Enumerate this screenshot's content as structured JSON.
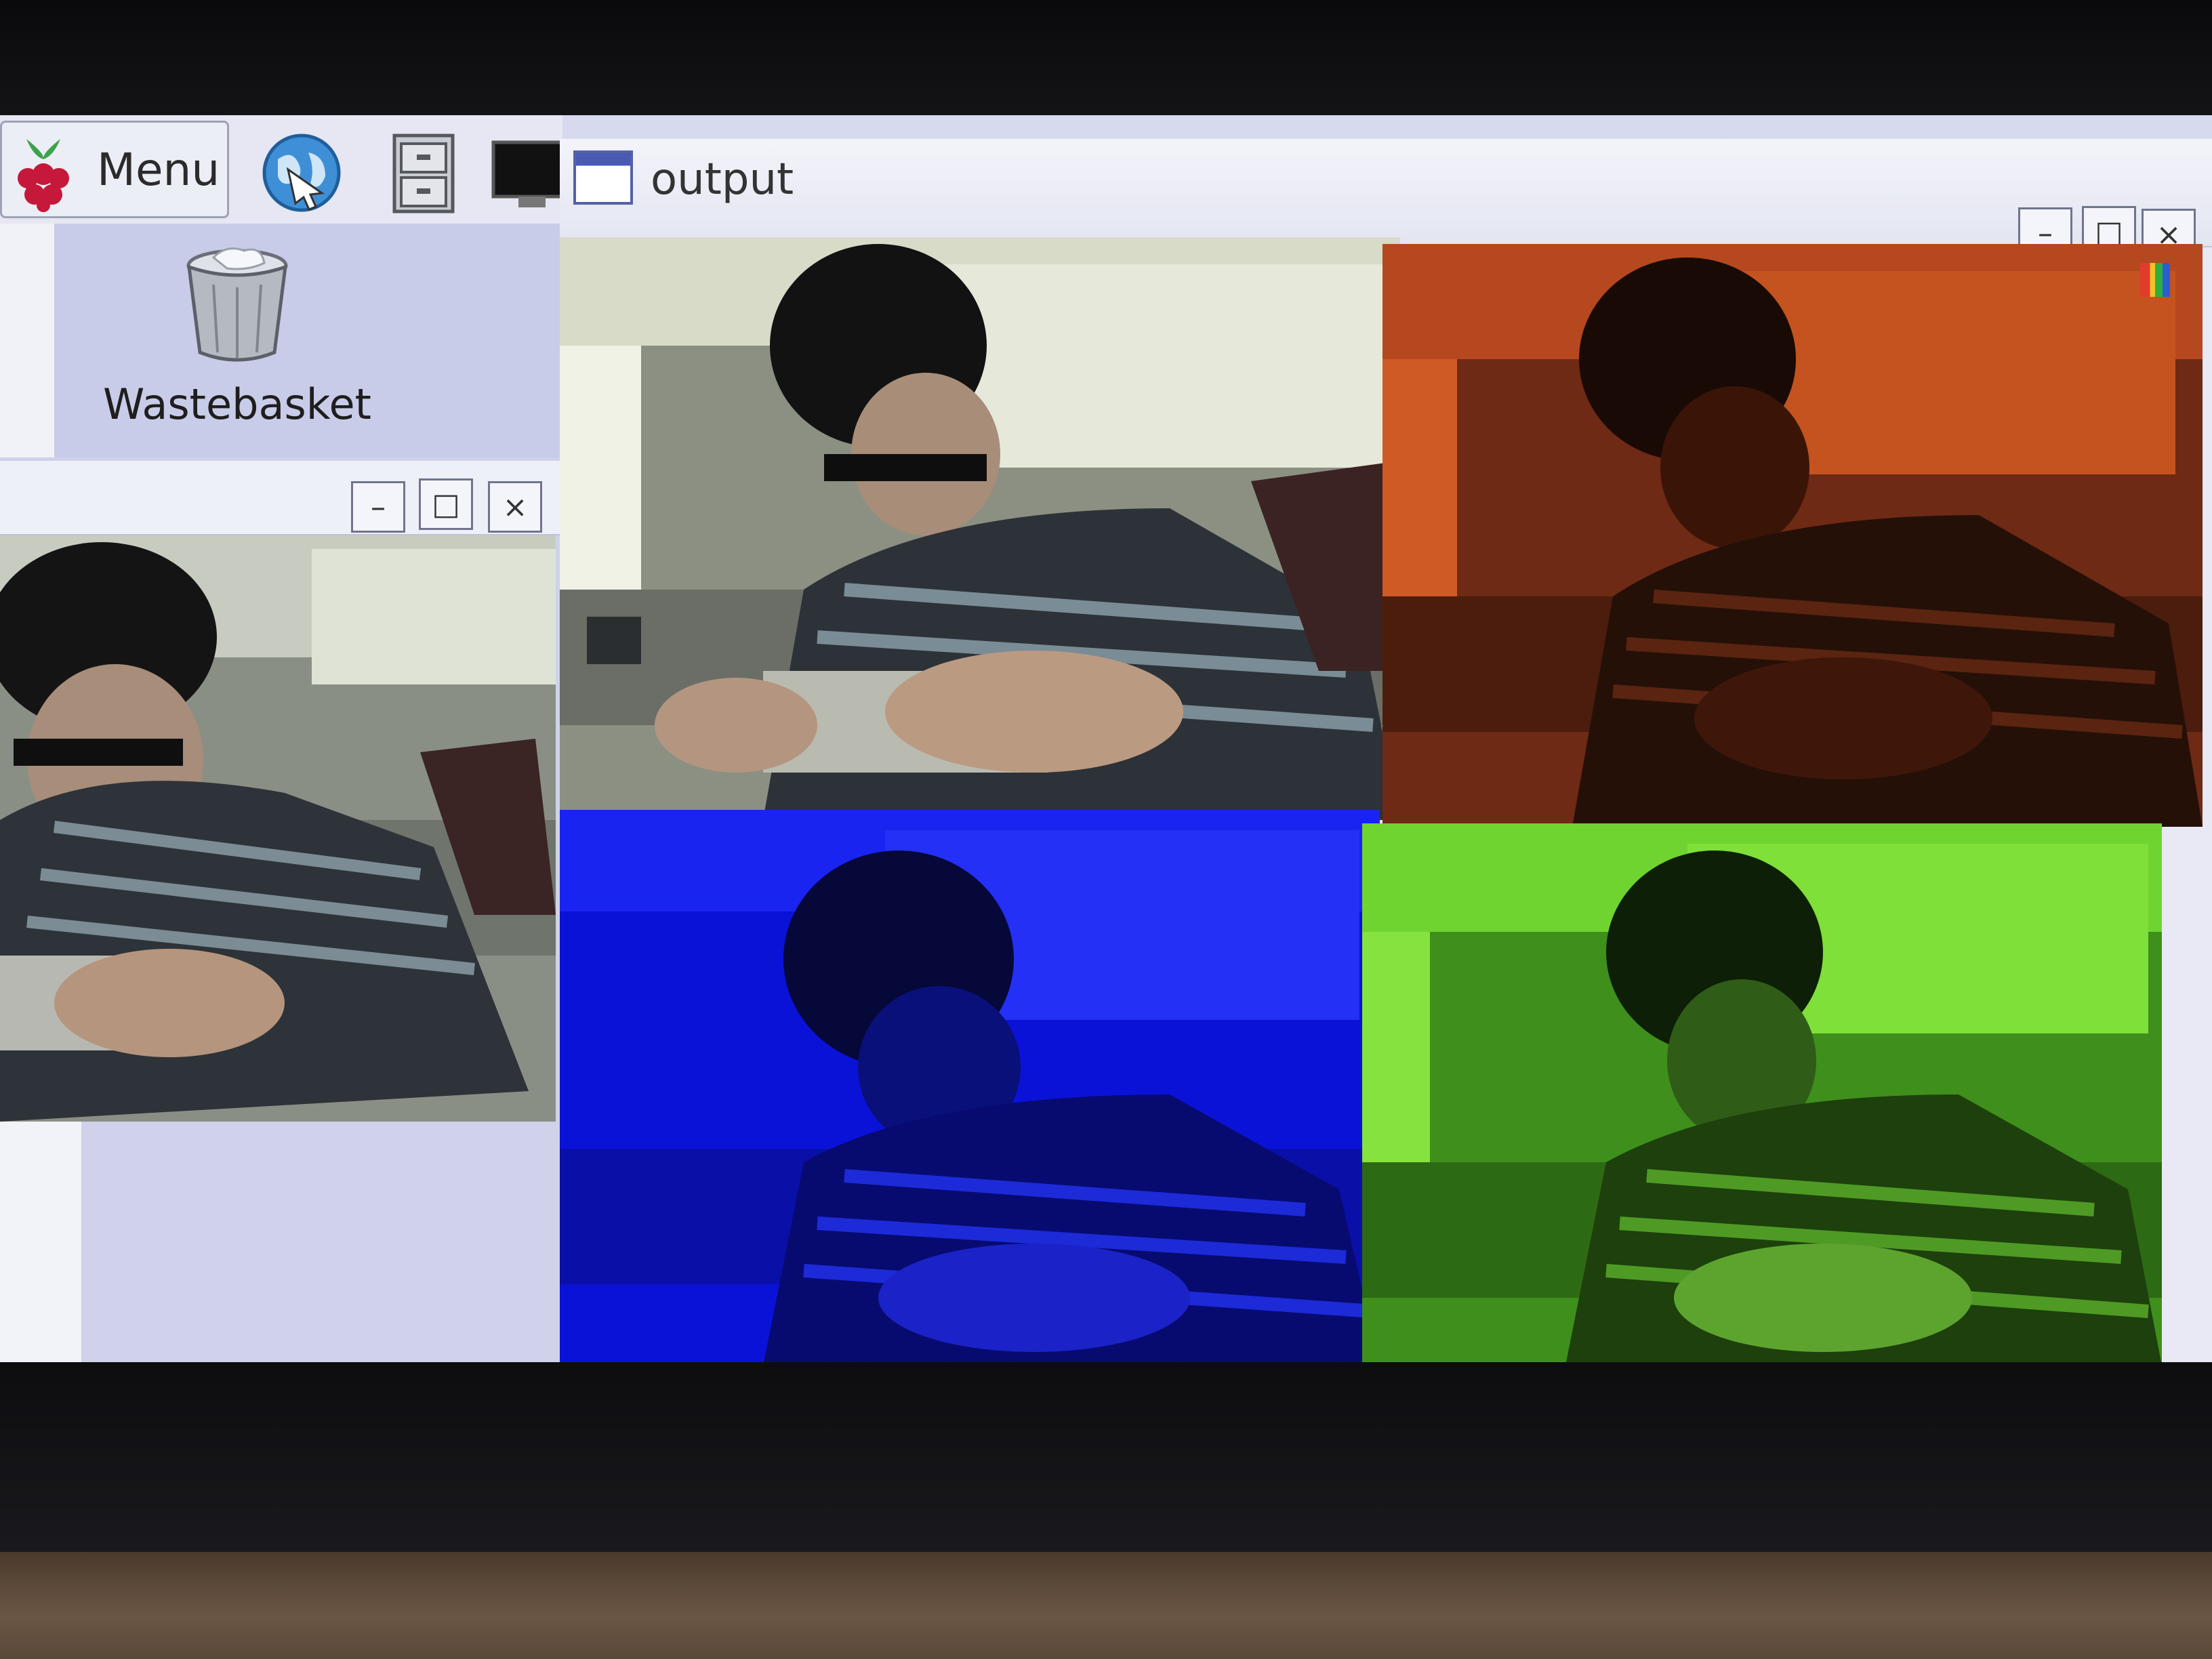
{
  "taskbar": {
    "menu_label": "Menu",
    "icons": [
      "raspberry-pi-icon",
      "web-browser-icon",
      "file-manager-icon",
      "terminal-icon"
    ]
  },
  "desktop": {
    "wastebasket_label": "Wastebasket",
    "wastebasket_icon": "trash-icon"
  },
  "left_window": {
    "title": "",
    "buttons": {
      "minimize": "–",
      "maximize": "□",
      "close": "×"
    }
  },
  "output_window": {
    "title": "output",
    "buttons": {
      "minimize": "–",
      "maximize": "□",
      "close": "×"
    },
    "panels": [
      "original",
      "red-channel",
      "blue-channel",
      "green-channel"
    ]
  },
  "colors": {
    "red_tint": "#b03a14",
    "blue_tint": "#1010e6",
    "green_tint": "#5fd62a",
    "titlebar": "#eef0f8",
    "desktop": "#c9cce8"
  }
}
